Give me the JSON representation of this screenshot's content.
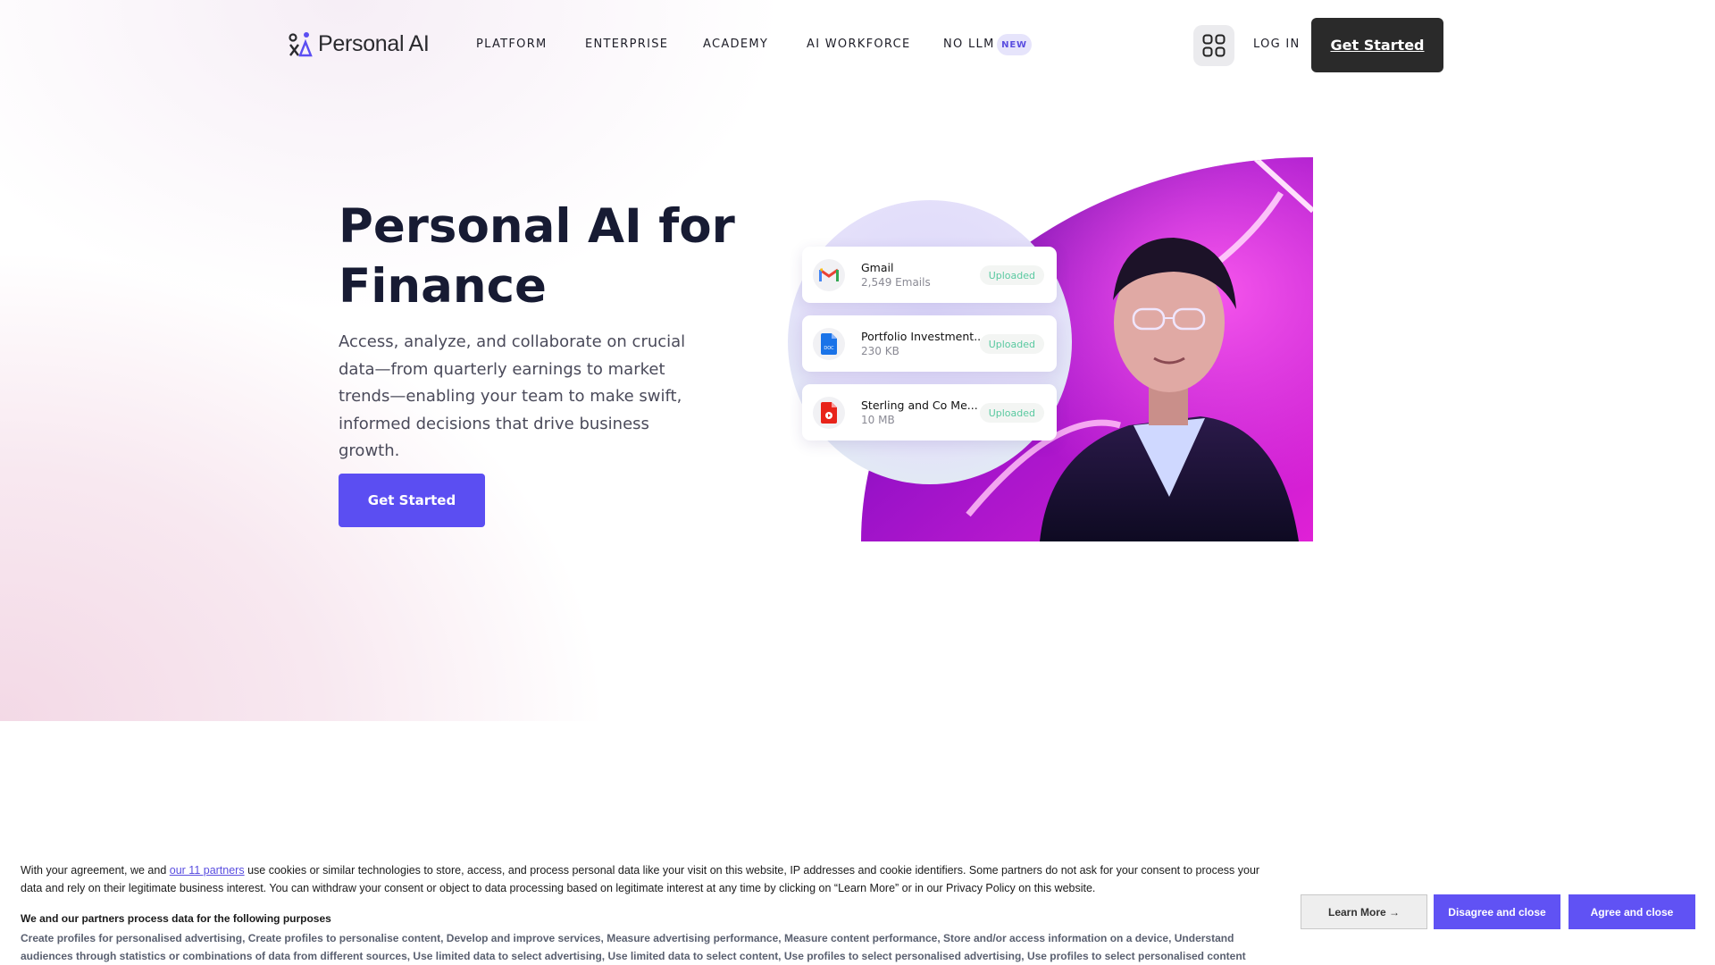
{
  "nav": {
    "logo_text": "Personal AI",
    "items": [
      "PLATFORM",
      "ENTERPRISE",
      "ACADEMY",
      "AI WORKFORCE",
      "NO LLM"
    ],
    "new_badge": "NEW",
    "login": "LOG IN",
    "cta": "Get Started"
  },
  "hero": {
    "title_line1": "Personal AI for",
    "title_line2": "Finance",
    "description": "Access, analyze, and collaborate on crucial data—from quarterly earnings to market trends—enabling your team to make swift, informed decisions that drive business growth.",
    "cta": "Get Started"
  },
  "uploads": [
    {
      "name": "Gmail",
      "sub": "2,549 Emails",
      "status": "Uploaded",
      "icon": "gmail-icon"
    },
    {
      "name": "Portfolio Investment...",
      "sub": "230 KB",
      "status": "Uploaded",
      "icon": "doc-icon"
    },
    {
      "name": "Sterling and Co Me...",
      "sub": "10 MB",
      "status": "Uploaded",
      "icon": "media-icon"
    }
  ],
  "consent": {
    "text_before_link": "With your agreement, we and ",
    "partners_link": "our 11 partners",
    "text_after_link": " use cookies or similar technologies to store, access, and process personal data like your visit on this website, IP addresses and cookie identifiers. Some partners do not ask for your consent to process your data and rely on their legitimate business interest. You can withdraw your consent or object to data processing based on legitimate interest at any time by clicking on “Learn More” or in our Privacy Policy on this website.",
    "purposes_title": "We and our partners process data for the following purposes",
    "purposes_list": "Create profiles for personalised advertising, Create profiles to personalise content, Develop and improve services, Measure advertising performance, Measure content performance, Store and/or access information on a device, Understand audiences through statistics or combinations of data from different sources, Use limited data to select advertising, Use limited data to select content, Use profiles to select personalised advertising, Use profiles to select personalised content",
    "learn_more": "Learn More →",
    "disagree": "Disagree and close",
    "agree": "Agree and close"
  },
  "colors": {
    "accent": "#5b4ef2",
    "dark_button": "#2a2a2a",
    "uploaded_green": "#59c9a0"
  }
}
